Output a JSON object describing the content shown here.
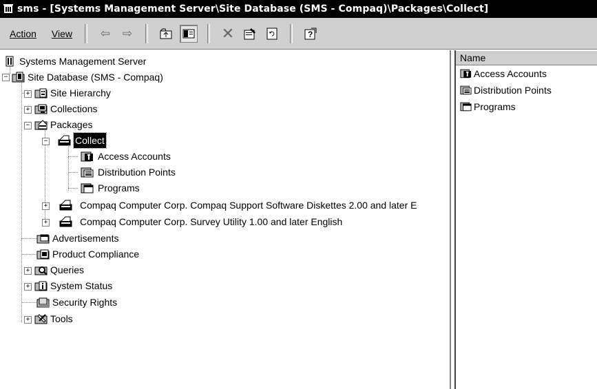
{
  "window": {
    "app_short": "sms",
    "title": "sms - [Systems Management Server\\Site Database (SMS - Compaq)\\Packages\\Collect]"
  },
  "menu": {
    "action": "Action",
    "view": "View"
  },
  "toolbar_icons": [
    "back-arrow-icon",
    "forward-arrow-icon",
    "up-folder-icon",
    "show-tree-icon",
    "delete-icon",
    "properties-icon",
    "refresh-icon",
    "help-icon"
  ],
  "tree": {
    "root": "Systems Management Server",
    "site_db": "Site Database (SMS - Compaq)",
    "site_hierarchy": "Site Hierarchy",
    "collections": "Collections",
    "packages": "Packages",
    "collect": "Collect",
    "access_accounts": "Access Accounts",
    "distribution_points": "Distribution Points",
    "programs": "Programs",
    "compaq_support": "Compaq Computer Corp. Compaq Support Software Diskettes 2.00 and later E",
    "compaq_survey": "Compaq Computer Corp. Survey Utility 1.00 and later English",
    "advertisements": "Advertisements",
    "product_compliance": "Product Compliance",
    "queries": "Queries",
    "system_status": "System Status",
    "security_rights": "Security Rights",
    "tools": "Tools"
  },
  "list": {
    "column_name": "Name",
    "items": [
      "Access Accounts",
      "Distribution Points",
      "Programs"
    ]
  }
}
